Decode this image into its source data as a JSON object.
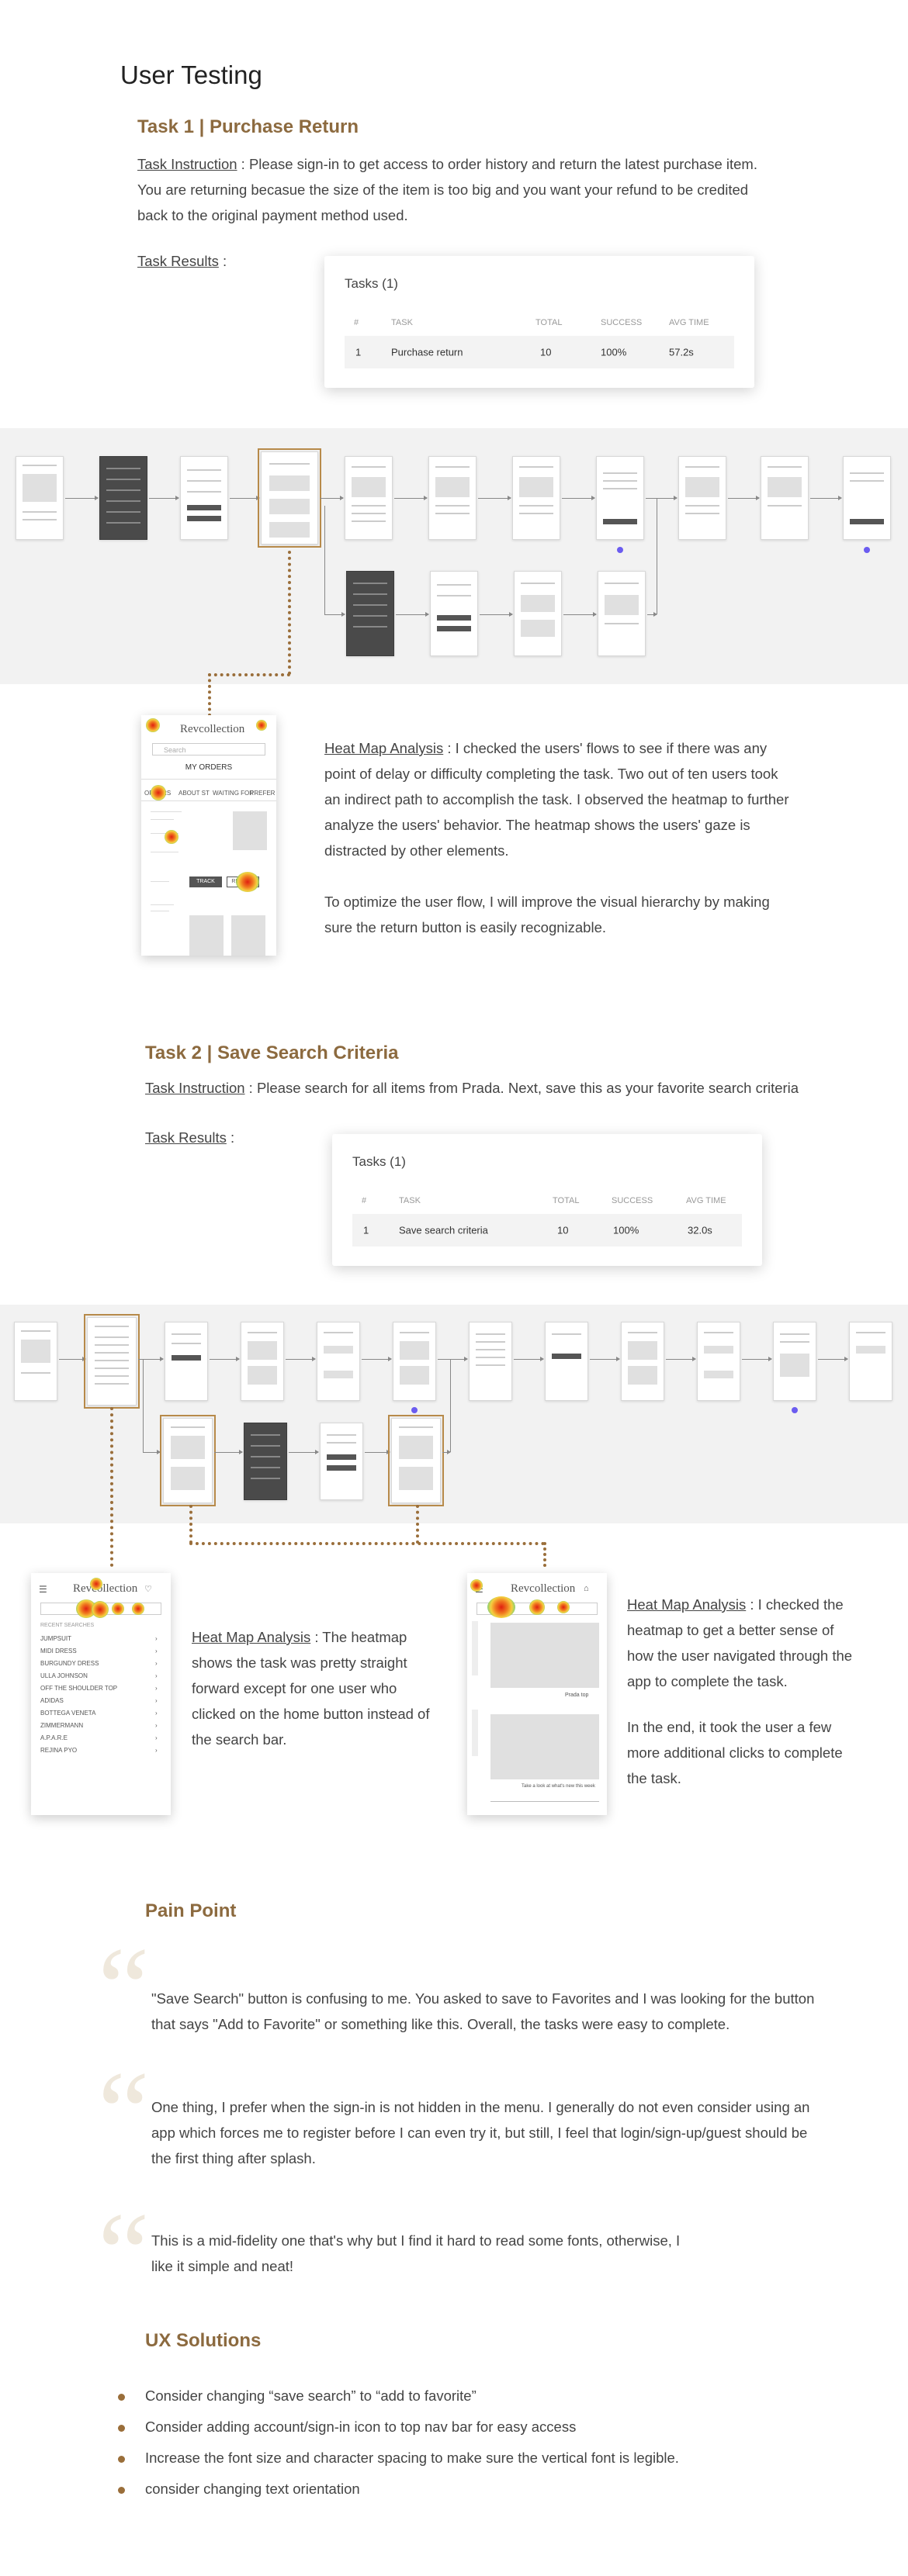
{
  "page_title": "User Testing",
  "task1": {
    "title": "Task 1 | Purchase Return",
    "instruction_label": "Task  Instruction",
    "instruction_text": " : Please sign-in to get access to order history and return the latest purchase item. You are returning becasue the size of the item is too big and you want your refund to be credited back to the original payment method used.",
    "results_label": "Task  Results",
    "results_colon": " :",
    "card": {
      "title": "Tasks (1)",
      "headers": [
        "#",
        "TASK",
        "TOTAL",
        "SUCCESS",
        "AVG TIME"
      ],
      "row": [
        "1",
        "Purchase return",
        "10",
        "100%",
        "57.2s"
      ]
    },
    "heatmap_label": "Heat Map Analysis",
    "heatmap_text": " : I checked the users' flows to see if there was any point of delay or difficulty completing the task. Two out of ten users took an indirect path to accomplish the task. I observed the heatmap to further analyze the users' behavior. The heatmap shows the users' gaze is distracted by other elements.",
    "heatmap_text2": "To optimize the user flow, I will improve the visual hierarchy by making sure the return button is easily recognizable.",
    "phone": {
      "logo": "Revcollection",
      "search_placeholder": "Search",
      "heading": "MY ORDERS",
      "tabs": [
        "ORDERS",
        "ABOUT ST",
        "WAITING FOR",
        "PREFER"
      ],
      "return_button": "RETURN",
      "track_button": "TRACK"
    }
  },
  "task2": {
    "title": "Task 2 | Save Search Criteria",
    "instruction_label": "Task  Instruction",
    "instruction_text": " : Please search for all items from Prada. Next, save this as your favorite search criteria",
    "results_label": "Task  Results",
    "results_colon": " :",
    "card": {
      "title": "Tasks (1)",
      "headers": [
        "#",
        "TASK",
        "TOTAL",
        "SUCCESS",
        "AVG TIME"
      ],
      "row": [
        "1",
        "Save search criteria",
        "10",
        "100%",
        "32.0s"
      ]
    },
    "heatmap1_label": "Heat Map Analysis",
    "heatmap1_text": " : The heatmap shows the task was pretty straight forward except for one user who clicked on the home button instead of the search bar.",
    "heatmap2_label": "Heat Map Analysis",
    "heatmap2_text": " : I checked the heatmap to get a better sense of how the user navigated through the app to complete the task.",
    "heatmap2_text2": "In the end, it took the user a few more additional clicks to complete the task.",
    "phone_left": {
      "logo": "Revcollection",
      "section": "RECENT SEARCHES",
      "items": [
        "JUMPSUIT",
        "MIDI DRESS",
        "BURGUNDY DRESS",
        "ULLA JOHNSON",
        "OFF THE SHOULDER TOP",
        "ADIDAS",
        "BOTTEGA VENETA",
        "ZIMMERMANN",
        "A.P.A.R.E",
        "REJINA PYO"
      ]
    },
    "phone_right": {
      "logo": "Revcollection",
      "caption1": "Prada top",
      "caption2": "Take a look at what's new this week"
    }
  },
  "pain_point": {
    "title": "Pain Point",
    "quotes": [
      "\"Save Search\" button is confusing to me. You asked to save to Favorites and I was looking for the button that says \"Add to Favorite\" or something like this. Overall, the tasks were easy to complete.",
      "One thing, I prefer when the sign-in is not hidden in the menu. I generally do not even consider using an app which forces me to register before I can even try it, but still, I feel that login/sign-up/guest should be the first thing after splash.",
      "This is a mid-fidelity one that's why but I find it hard to read some fonts, otherwise, I like it simple and neat!"
    ]
  },
  "ux_solutions": {
    "title": "UX Solutions",
    "items": [
      "Consider changing “save search” to “add to favorite”",
      "Consider adding account/sign-in icon to top nav bar for easy access",
      "Increase the font size and character spacing to  make sure the vertical font is legible.",
      "consider changing text orientation"
    ]
  },
  "colors": {
    "accent": "#8c6a3f",
    "band": "#f2f2f2",
    "quote_mark": "#efe8dc",
    "path_dot": "#6b5cf0"
  }
}
